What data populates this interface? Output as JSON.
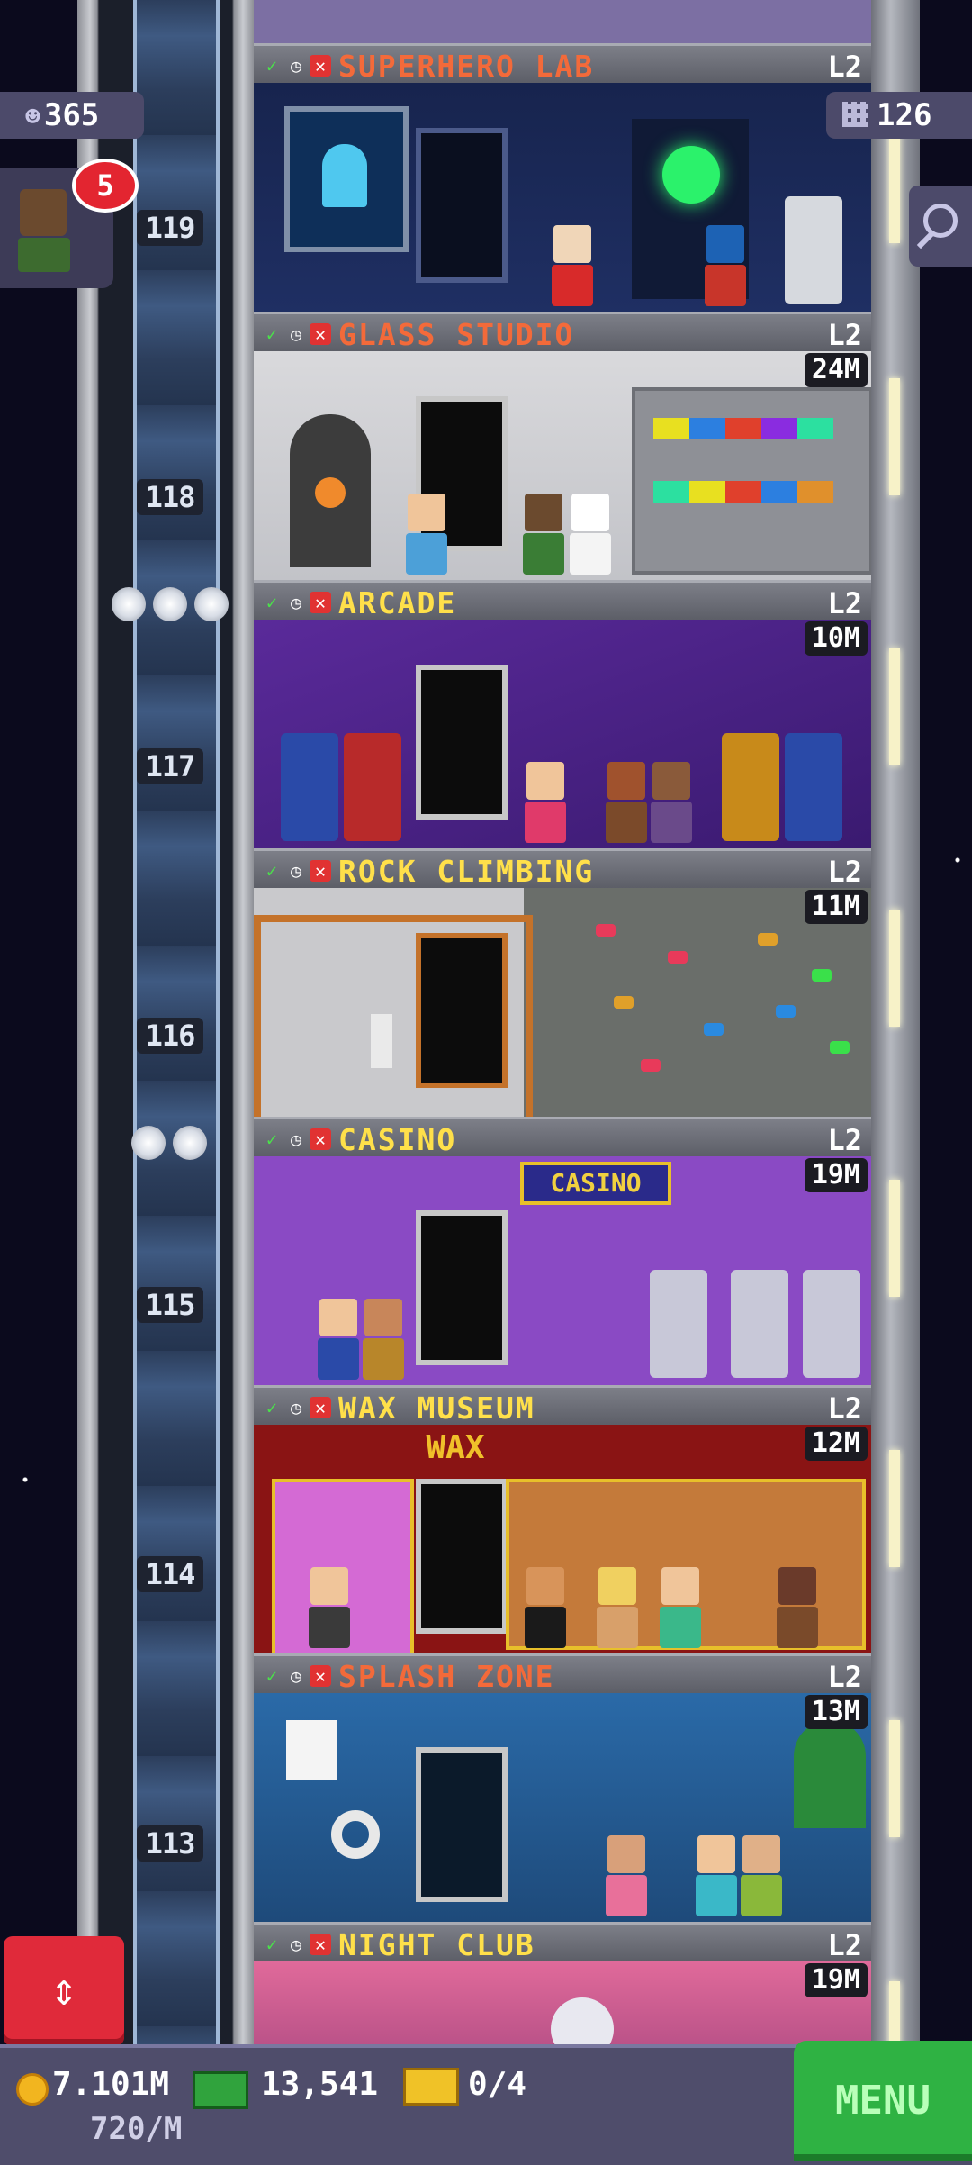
{
  "top": {
    "population": "365",
    "bits": "126",
    "notification_count": "5"
  },
  "floors": [
    {
      "id": "119",
      "name": "SUPERHERO LAB",
      "level": "L2",
      "price": "",
      "name_color": "#f36a3a"
    },
    {
      "id": "118",
      "name": "GLASS STUDIO",
      "level": "L2",
      "price": "24M",
      "name_color": "#f36a3a"
    },
    {
      "id": "117",
      "name": "ARCADE",
      "level": "L2",
      "price": "10M",
      "name_color": "#ffe04a"
    },
    {
      "id": "116",
      "name": "ROCK CLIMBING",
      "level": "L2",
      "price": "11M",
      "name_color": "#ffe04a"
    },
    {
      "id": "115",
      "name": "CASINO",
      "level": "L2",
      "price": "19M",
      "name_color": "#ffe04a",
      "sign": "CASINO"
    },
    {
      "id": "114",
      "name": "WAX MUSEUM",
      "level": "L2",
      "price": "12M",
      "name_color": "#ffe04a",
      "sign": "WAX"
    },
    {
      "id": "113",
      "name": "SPLASH ZONE",
      "level": "L2",
      "price": "13M",
      "name_color": "#f36a3a"
    },
    {
      "id": "112",
      "name": "NIGHT CLUB",
      "level": "L2",
      "price": "19M",
      "name_color": "#ffe04a"
    }
  ],
  "bottom": {
    "coins": "7.101M",
    "coin_rate": "720/M",
    "tower_bux": "13,541",
    "tickets": "0/4",
    "menu_label": "MENU"
  },
  "icons": {
    "check": "✓",
    "clock": "◷",
    "x": "✕",
    "updown": "⇕",
    "person": "☻"
  }
}
